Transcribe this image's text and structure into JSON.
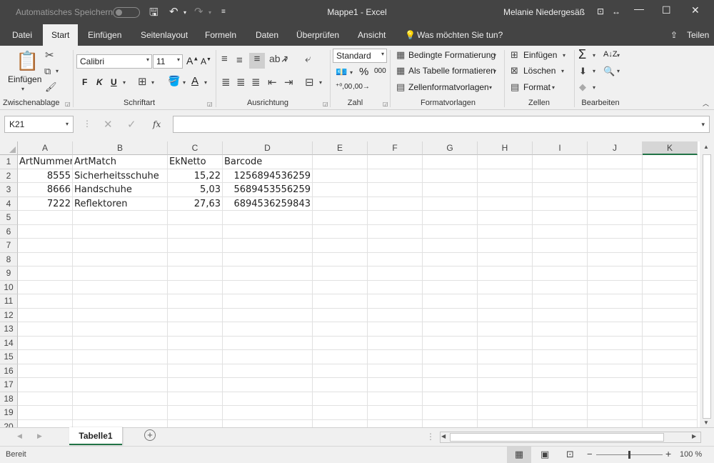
{
  "titlebar": {
    "autosave_label": "Automatisches Speichern",
    "window_title": "Mappe1  -  Excel",
    "user_name": "Melanie Niedergesäß"
  },
  "tabs": [
    "Datei",
    "Start",
    "Einfügen",
    "Seitenlayout",
    "Formeln",
    "Daten",
    "Überprüfen",
    "Ansicht"
  ],
  "active_tab": "Start",
  "tell_me": "Was möchten Sie tun?",
  "share_label": "Teilen",
  "ribbon": {
    "clipboard": {
      "paste_label": "Einfügen",
      "group_label": "Zwischenablage"
    },
    "font": {
      "font_name": "Calibri",
      "font_size": "11",
      "bold": "F",
      "italic": "K",
      "underline": "U",
      "group_label": "Schriftart"
    },
    "alignment": {
      "group_label": "Ausrichtung"
    },
    "number": {
      "format": "Standard",
      "group_label": "Zahl"
    },
    "styles": {
      "conditional": "Bedingte Formatierung",
      "as_table": "Als Tabelle formatieren",
      "cell_styles": "Zellenformatvorlagen",
      "group_label": "Formatvorlagen"
    },
    "cells": {
      "insert": "Einfügen",
      "delete": "Löschen",
      "format": "Format",
      "group_label": "Zellen"
    },
    "editing": {
      "group_label": "Bearbeiten"
    }
  },
  "formula_bar": {
    "name_box": "K21",
    "fx": "fx",
    "content": ""
  },
  "sheet": {
    "columns": [
      "A",
      "B",
      "C",
      "D",
      "E",
      "F",
      "G",
      "H",
      "I",
      "J",
      "K"
    ],
    "selected_column": "K",
    "row_numbers": [
      "1",
      "2",
      "3",
      "4",
      "5",
      "6",
      "7",
      "8",
      "9",
      "10",
      "11",
      "12",
      "13",
      "14",
      "15",
      "16",
      "17",
      "18",
      "19",
      "20"
    ],
    "rows": [
      [
        "ArtNummer",
        "ArtMatch",
        "EkNetto",
        "Barcode"
      ],
      [
        "8555",
        "Sicherheitsschuhe",
        "15,22",
        "1256894536259"
      ],
      [
        "8666",
        "Handschuhe",
        "5,03",
        "5689453556259"
      ],
      [
        "7222",
        "Reflektoren",
        "27,63",
        "6894536259843"
      ]
    ]
  },
  "sheet_tabs": [
    "Tabelle1"
  ],
  "status": {
    "mode": "Bereit",
    "zoom": "100 %"
  }
}
